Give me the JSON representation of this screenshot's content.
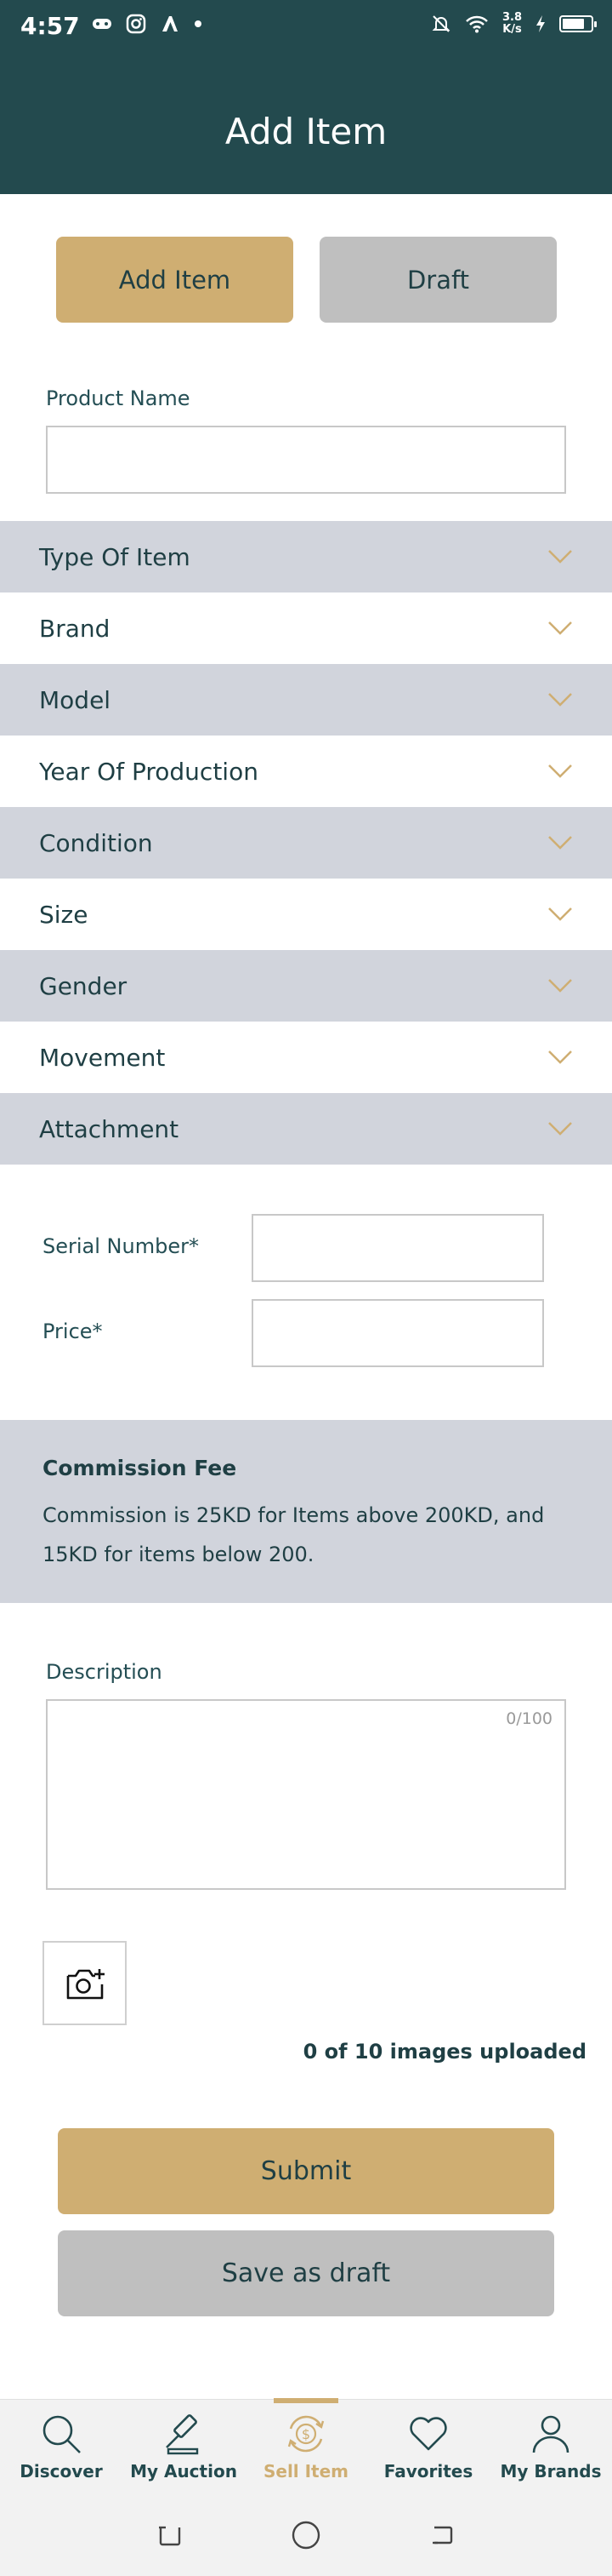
{
  "status_bar": {
    "time": "4:57",
    "net_speed_value": "3.8",
    "net_speed_unit": "K/s"
  },
  "header": {
    "title": "Add Item"
  },
  "mode_tabs": {
    "add_label": "Add Item",
    "draft_label": "Draft"
  },
  "product_name": {
    "label": "Product Name",
    "value": "",
    "placeholder": ""
  },
  "dropdowns": [
    {
      "label": "Type Of Item"
    },
    {
      "label": "Brand"
    },
    {
      "label": "Model"
    },
    {
      "label": "Year Of Production"
    },
    {
      "label": "Condition"
    },
    {
      "label": "Size"
    },
    {
      "label": "Gender"
    },
    {
      "label": "Movement"
    },
    {
      "label": "Attachment"
    }
  ],
  "serial_number": {
    "label": "Serial Number*",
    "value": ""
  },
  "price": {
    "label": "Price*",
    "value": ""
  },
  "commission": {
    "title": "Commission Fee",
    "text": "Commission is 25KD for Items above 200KD, and 15KD for items below 200."
  },
  "description": {
    "label": "Description",
    "value": "",
    "counter": "0/100"
  },
  "images": {
    "uploaded_text": "0 of 10 images uploaded"
  },
  "actions": {
    "submit_label": "Submit",
    "save_draft_label": "Save as draft"
  },
  "bottom_nav": [
    {
      "label": "Discover",
      "icon": "search-icon"
    },
    {
      "label": "My Auction",
      "icon": "gavel-icon"
    },
    {
      "label": "Sell Item",
      "icon": "dollar-cycle-icon",
      "active": true
    },
    {
      "label": "Favorites",
      "icon": "heart-icon"
    },
    {
      "label": "My Brands",
      "icon": "user-icon"
    }
  ],
  "colors": {
    "header_bg": "#234a4e",
    "accent_gold": "#cfae72",
    "neutral_gray": "#bfbfbf",
    "row_shade": "#d1d4dc",
    "text_dark": "#1f3f44"
  }
}
